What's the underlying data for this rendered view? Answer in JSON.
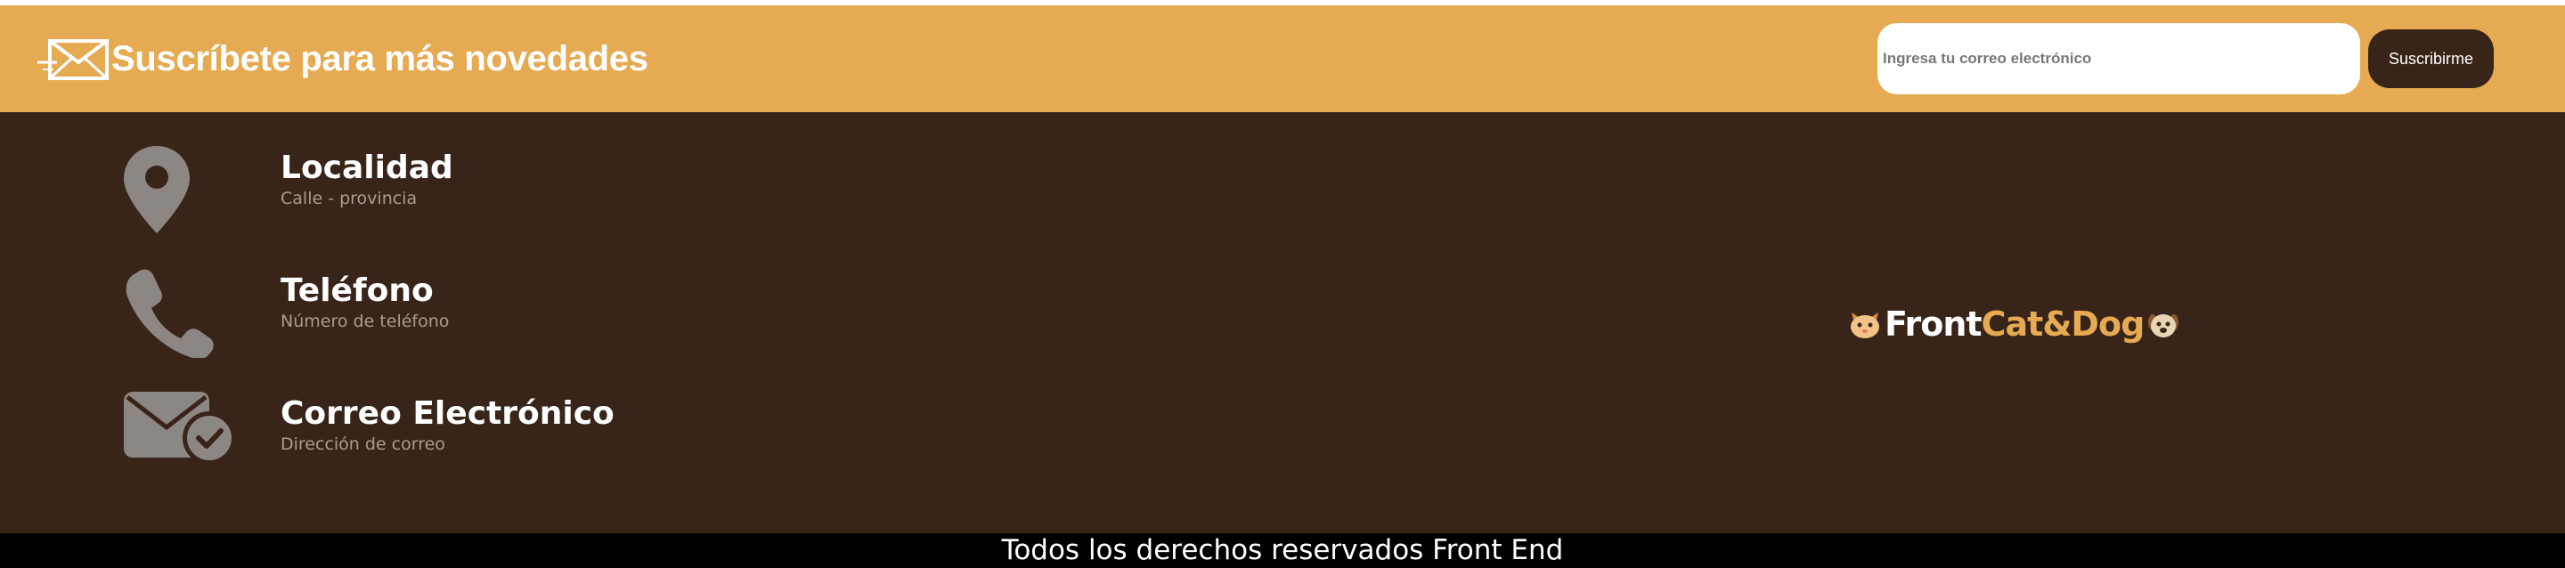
{
  "subscribe": {
    "icon": "envelope-speed-icon",
    "title": "Suscríbete para más novedades",
    "email_placeholder": "Ingresa tu correo electrónico",
    "email_value": "",
    "button_label": "Suscribirme",
    "colors": {
      "background": "#e5aa52",
      "button": "#382418"
    }
  },
  "contact": {
    "items": [
      {
        "icon": "map-pin-icon",
        "title": "Localidad",
        "subtitle": "Calle - provincia"
      },
      {
        "icon": "phone-icon",
        "title": "Teléfono",
        "subtitle": "Número de teléfono"
      },
      {
        "icon": "mail-check-icon",
        "title": "Correo Electrónico",
        "subtitle": "Dirección de correo"
      }
    ]
  },
  "brand": {
    "part1": "Front",
    "part2": "Cat&Dog",
    "left_icon": "cat-face-icon",
    "right_icon": "dog-face-icon",
    "colors": {
      "part1": "#ffffff",
      "part2": "#e5aa52"
    }
  },
  "footer": {
    "copyright": "Todos los derechos reservados Front End",
    "colors": {
      "background": "#382418",
      "copyright_bar": "#000000"
    }
  }
}
